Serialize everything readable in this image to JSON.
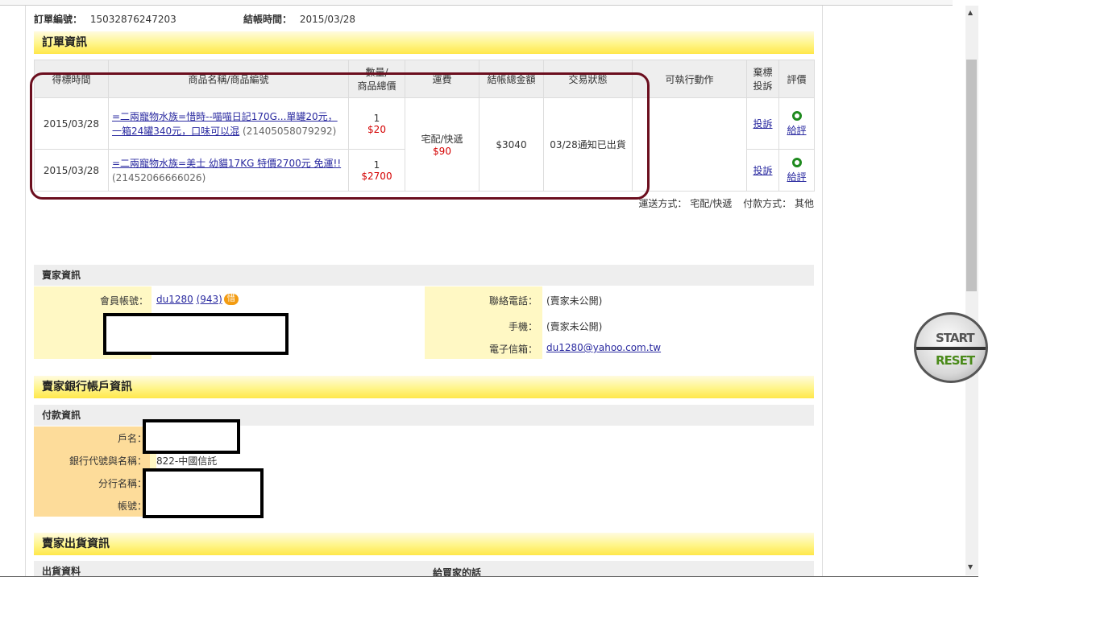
{
  "order": {
    "number_label": "訂單編號：",
    "number": "15032876247203",
    "checkout_label": "結帳時間：",
    "checkout_time": "2015/03/28"
  },
  "sections": {
    "order_info": "訂單資訊",
    "seller_info": "賣家資訊",
    "seller_bank": "賣家銀行帳戶資訊",
    "payment_info": "付款資訊",
    "seller_ship": "賣家出貨資訊",
    "ship_data": "出貨資料",
    "to_buyer": "給買家的話"
  },
  "table": {
    "headers": {
      "win_time": "得標時間",
      "product": "商品名稱/商品編號",
      "qty_line1": "數量/",
      "qty_line2": "商品總價",
      "shipping": "運費",
      "total": "結帳總金額",
      "status": "交易狀態",
      "actions": "可執行動作",
      "abandon_line1": "棄標",
      "abandon_line2": "投訴",
      "rating": "評價"
    },
    "rows": [
      {
        "date": "2015/03/28",
        "product_link": "=二兩寵物水族=惜時--喵喵日記170G...單罐20元，一箱24罐340元，口味可以混",
        "product_id": "(21405058079292)",
        "qty": "1",
        "price": "$20",
        "complain": "投訴",
        "rate": "給評"
      },
      {
        "date": "2015/03/28",
        "product_link": "=二兩寵物水族=美士 幼貓17KG 特價2700元 免運!!",
        "product_id": "(21452066666026)",
        "qty": "1",
        "price": "$2700",
        "complain": "投訴",
        "rate": "給評"
      }
    ],
    "shipping_method": "宅配/快遞",
    "shipping_fee": "$90",
    "total": "$3040",
    "status": "03/28通知已出貨"
  },
  "summary": {
    "delivery_label": "運送方式：",
    "delivery": "宅配/快遞",
    "payment_label": "付款方式：",
    "payment": "其他"
  },
  "seller": {
    "account_label": "會員帳號：",
    "account": "du1280",
    "score": "(943)",
    "badge": "惜",
    "phone_label": "聯絡電話：",
    "phone": "(賣家未公開)",
    "mobile_label": "手機：",
    "mobile": "(賣家未公開)",
    "email_label": "電子信箱：",
    "email": "du1280@yahoo.com.tw"
  },
  "bank": {
    "name_label": "戶名：",
    "code_label": "銀行代號與名稱：",
    "code": "822-中國信託",
    "branch_label": "分行名稱：",
    "account_label": "帳號："
  },
  "overlay": {
    "start": "START",
    "reset": "RESET"
  },
  "colors": {
    "highlight_box": "#6b0e1e",
    "price": "#d40000",
    "yellow_header": "#ffe74a"
  }
}
